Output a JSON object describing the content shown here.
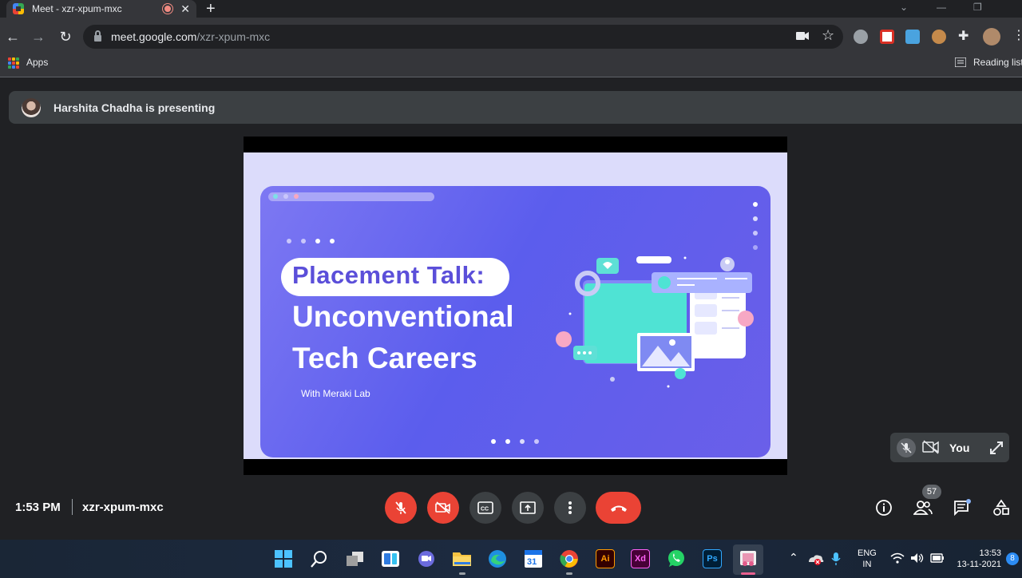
{
  "browser": {
    "tab_title": "Meet - xzr-xpum-mxc",
    "tab_close": "✕",
    "new_tab": "+",
    "url_host": "meet.google.com",
    "url_path": "/xzr-xpum-mxc",
    "bookmarks_apps": "Apps",
    "reading_list": "Reading list"
  },
  "meet": {
    "presenter_text": "Harshita Chadha is presenting",
    "slide": {
      "title_line1": "Placement Talk:",
      "title_line2": "Unconventional",
      "title_line3": "Tech Careers",
      "subtitle": "With Meraki Lab"
    },
    "self_tile_label": "You",
    "time": "1:53 PM",
    "meeting_code": "xzr-xpum-mxc",
    "participants_count": "57",
    "colors": {
      "red": "#ea4335",
      "control_bg": "#3c4043",
      "slide_purple": "#5b5ded",
      "accent_blue": "#8ab4f8"
    }
  },
  "taskbar": {
    "lang_line1": "ENG",
    "lang_line2": "IN",
    "clock_time": "13:53",
    "clock_date": "13-11-2021",
    "notification_count": "8",
    "calendar_day": "31",
    "ai_label": "Ai",
    "xd_label": "Xd",
    "ps_label": "Ps"
  }
}
